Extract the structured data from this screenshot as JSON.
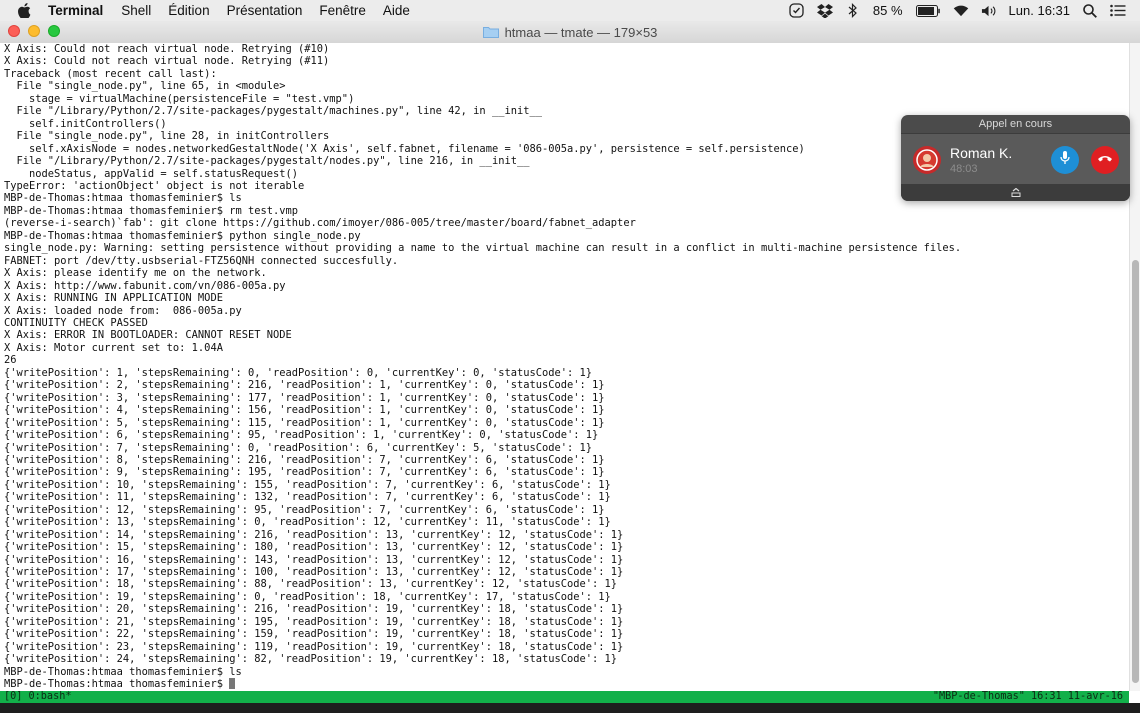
{
  "menubar": {
    "app_name": "Terminal",
    "items": [
      "Shell",
      "Édition",
      "Présentation",
      "Fenêtre",
      "Aide"
    ],
    "battery": "85 %",
    "clock": "Lun. 16:31"
  },
  "window": {
    "title": "htmaa — tmate — 179×53"
  },
  "terminal": {
    "lines": [
      "X Axis: Could not reach virtual node. Retrying (#10)",
      "X Axis: Could not reach virtual node. Retrying (#11)",
      "Traceback (most recent call last):",
      "  File \"single_node.py\", line 65, in <module>",
      "    stage = virtualMachine(persistenceFile = \"test.vmp\")",
      "  File \"/Library/Python/2.7/site-packages/pygestalt/machines.py\", line 42, in __init__",
      "    self.initControllers()",
      "  File \"single_node.py\", line 28, in initControllers",
      "    self.xAxisNode = nodes.networkedGestaltNode('X Axis', self.fabnet, filename = '086-005a.py', persistence = self.persistence)",
      "  File \"/Library/Python/2.7/site-packages/pygestalt/nodes.py\", line 216, in __init__",
      "    nodeStatus, appValid = self.statusRequest()",
      "TypeError: 'actionObject' object is not iterable",
      "MBP-de-Thomas:htmaa thomasfeminier$ ls",
      "MBP-de-Thomas:htmaa thomasfeminier$ rm test.vmp",
      "(reverse-i-search)`fab': git clone https://github.com/imoyer/086-005/tree/master/board/fabnet_adapter",
      "MBP-de-Thomas:htmaa thomasfeminier$ python single_node.py",
      "single_node.py: Warning: setting persistence without providing a name to the virtual machine can result in a conflict in multi-machine persistence files.",
      "FABNET: port /dev/tty.usbserial-FTZ56QNH connected succesfully.",
      "X Axis: please identify me on the network.",
      "X Axis: http://www.fabunit.com/vn/086-005a.py",
      "X Axis: RUNNING IN APPLICATION MODE",
      "X Axis: loaded node from:  086-005a.py",
      "CONTINUITY CHECK PASSED",
      "X Axis: ERROR IN BOOTLOADER: CANNOT RESET NODE",
      "X Axis: Motor current set to: 1.04A",
      "26",
      "{'writePosition': 1, 'stepsRemaining': 0, 'readPosition': 0, 'currentKey': 0, 'statusCode': 1}",
      "{'writePosition': 2, 'stepsRemaining': 216, 'readPosition': 1, 'currentKey': 0, 'statusCode': 1}",
      "{'writePosition': 3, 'stepsRemaining': 177, 'readPosition': 1, 'currentKey': 0, 'statusCode': 1}",
      "{'writePosition': 4, 'stepsRemaining': 156, 'readPosition': 1, 'currentKey': 0, 'statusCode': 1}",
      "{'writePosition': 5, 'stepsRemaining': 115, 'readPosition': 1, 'currentKey': 0, 'statusCode': 1}",
      "{'writePosition': 6, 'stepsRemaining': 95, 'readPosition': 1, 'currentKey': 0, 'statusCode': 1}",
      "{'writePosition': 7, 'stepsRemaining': 0, 'readPosition': 6, 'currentKey': 5, 'statusCode': 1}",
      "{'writePosition': 8, 'stepsRemaining': 216, 'readPosition': 7, 'currentKey': 6, 'statusCode': 1}",
      "{'writePosition': 9, 'stepsRemaining': 195, 'readPosition': 7, 'currentKey': 6, 'statusCode': 1}",
      "{'writePosition': 10, 'stepsRemaining': 155, 'readPosition': 7, 'currentKey': 6, 'statusCode': 1}",
      "{'writePosition': 11, 'stepsRemaining': 132, 'readPosition': 7, 'currentKey': 6, 'statusCode': 1}",
      "{'writePosition': 12, 'stepsRemaining': 95, 'readPosition': 7, 'currentKey': 6, 'statusCode': 1}",
      "{'writePosition': 13, 'stepsRemaining': 0, 'readPosition': 12, 'currentKey': 11, 'statusCode': 1}",
      "{'writePosition': 14, 'stepsRemaining': 216, 'readPosition': 13, 'currentKey': 12, 'statusCode': 1}",
      "{'writePosition': 15, 'stepsRemaining': 180, 'readPosition': 13, 'currentKey': 12, 'statusCode': 1}",
      "{'writePosition': 16, 'stepsRemaining': 143, 'readPosition': 13, 'currentKey': 12, 'statusCode': 1}",
      "{'writePosition': 17, 'stepsRemaining': 100, 'readPosition': 13, 'currentKey': 12, 'statusCode': 1}",
      "{'writePosition': 18, 'stepsRemaining': 88, 'readPosition': 13, 'currentKey': 12, 'statusCode': 1}",
      "{'writePosition': 19, 'stepsRemaining': 0, 'readPosition': 18, 'currentKey': 17, 'statusCode': 1}",
      "{'writePosition': 20, 'stepsRemaining': 216, 'readPosition': 19, 'currentKey': 18, 'statusCode': 1}",
      "{'writePosition': 21, 'stepsRemaining': 195, 'readPosition': 19, 'currentKey': 18, 'statusCode': 1}",
      "{'writePosition': 22, 'stepsRemaining': 159, 'readPosition': 19, 'currentKey': 18, 'statusCode': 1}",
      "{'writePosition': 23, 'stepsRemaining': 119, 'readPosition': 19, 'currentKey': 18, 'statusCode': 1}",
      "{'writePosition': 24, 'stepsRemaining': 82, 'readPosition': 19, 'currentKey': 18, 'statusCode': 1}",
      "MBP-de-Thomas:htmaa thomasfeminier$ ls"
    ],
    "prompt": "MBP-de-Thomas:htmaa thomasfeminier$ "
  },
  "tmux": {
    "left": "[0] 0:bash*",
    "right": "\"MBP-de-Thomas\" 16:31 11-avr-16"
  },
  "call": {
    "header": "Appel en cours",
    "caller": "Roman K.",
    "duration": "48:03"
  },
  "colors": {
    "tmux_green": "#12b04a",
    "mute_blue": "#1e8fd6",
    "hangup_red": "#e01f22"
  },
  "icons": {
    "apple": "apple-icon",
    "mic": "microphone-icon",
    "hangup": "phone-hangup-icon"
  }
}
